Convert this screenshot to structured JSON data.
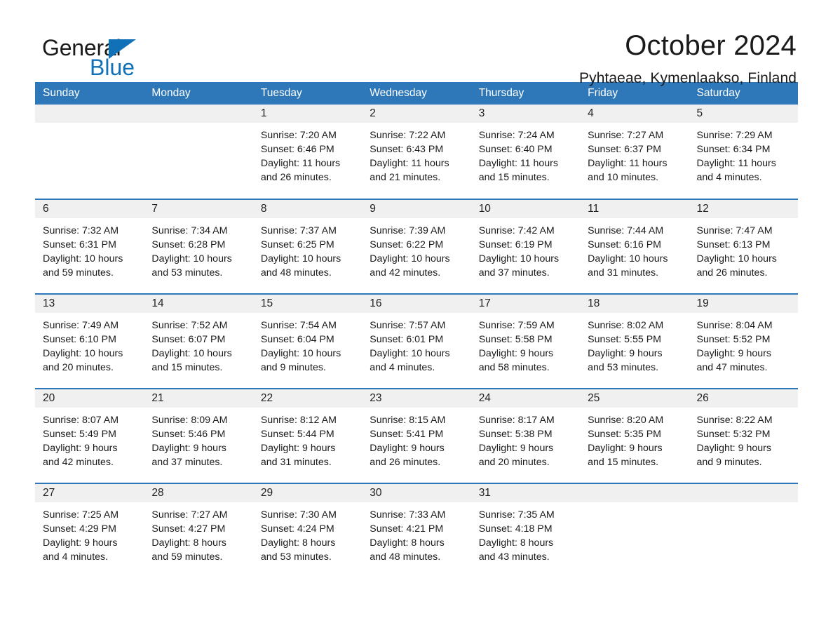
{
  "brand": {
    "name_part1": "General",
    "name_part2": "Blue",
    "logo_icon": "triangle-logo-icon",
    "accent_color": "#1071b8"
  },
  "header": {
    "month_title": "October 2024",
    "location": "Pyhtaeae, Kymenlaakso, Finland"
  },
  "colors": {
    "header_band": "#2e77b8",
    "week_divider": "#2e77b8",
    "daynum_strip": "#f0f0f0"
  },
  "calendar": {
    "weekday_headers": [
      "Sunday",
      "Monday",
      "Tuesday",
      "Wednesday",
      "Thursday",
      "Friday",
      "Saturday"
    ],
    "weeks": [
      [
        {
          "day": "",
          "empty": true,
          "sunrise": "",
          "sunset": "",
          "daylight_line1": "",
          "daylight_line2": ""
        },
        {
          "day": "",
          "empty": true,
          "sunrise": "",
          "sunset": "",
          "daylight_line1": "",
          "daylight_line2": ""
        },
        {
          "day": "1",
          "empty": false,
          "sunrise": "Sunrise: 7:20 AM",
          "sunset": "Sunset: 6:46 PM",
          "daylight_line1": "Daylight: 11 hours",
          "daylight_line2": "and 26 minutes."
        },
        {
          "day": "2",
          "empty": false,
          "sunrise": "Sunrise: 7:22 AM",
          "sunset": "Sunset: 6:43 PM",
          "daylight_line1": "Daylight: 11 hours",
          "daylight_line2": "and 21 minutes."
        },
        {
          "day": "3",
          "empty": false,
          "sunrise": "Sunrise: 7:24 AM",
          "sunset": "Sunset: 6:40 PM",
          "daylight_line1": "Daylight: 11 hours",
          "daylight_line2": "and 15 minutes."
        },
        {
          "day": "4",
          "empty": false,
          "sunrise": "Sunrise: 7:27 AM",
          "sunset": "Sunset: 6:37 PM",
          "daylight_line1": "Daylight: 11 hours",
          "daylight_line2": "and 10 minutes."
        },
        {
          "day": "5",
          "empty": false,
          "sunrise": "Sunrise: 7:29 AM",
          "sunset": "Sunset: 6:34 PM",
          "daylight_line1": "Daylight: 11 hours",
          "daylight_line2": "and 4 minutes."
        }
      ],
      [
        {
          "day": "6",
          "empty": false,
          "sunrise": "Sunrise: 7:32 AM",
          "sunset": "Sunset: 6:31 PM",
          "daylight_line1": "Daylight: 10 hours",
          "daylight_line2": "and 59 minutes."
        },
        {
          "day": "7",
          "empty": false,
          "sunrise": "Sunrise: 7:34 AM",
          "sunset": "Sunset: 6:28 PM",
          "daylight_line1": "Daylight: 10 hours",
          "daylight_line2": "and 53 minutes."
        },
        {
          "day": "8",
          "empty": false,
          "sunrise": "Sunrise: 7:37 AM",
          "sunset": "Sunset: 6:25 PM",
          "daylight_line1": "Daylight: 10 hours",
          "daylight_line2": "and 48 minutes."
        },
        {
          "day": "9",
          "empty": false,
          "sunrise": "Sunrise: 7:39 AM",
          "sunset": "Sunset: 6:22 PM",
          "daylight_line1": "Daylight: 10 hours",
          "daylight_line2": "and 42 minutes."
        },
        {
          "day": "10",
          "empty": false,
          "sunrise": "Sunrise: 7:42 AM",
          "sunset": "Sunset: 6:19 PM",
          "daylight_line1": "Daylight: 10 hours",
          "daylight_line2": "and 37 minutes."
        },
        {
          "day": "11",
          "empty": false,
          "sunrise": "Sunrise: 7:44 AM",
          "sunset": "Sunset: 6:16 PM",
          "daylight_line1": "Daylight: 10 hours",
          "daylight_line2": "and 31 minutes."
        },
        {
          "day": "12",
          "empty": false,
          "sunrise": "Sunrise: 7:47 AM",
          "sunset": "Sunset: 6:13 PM",
          "daylight_line1": "Daylight: 10 hours",
          "daylight_line2": "and 26 minutes."
        }
      ],
      [
        {
          "day": "13",
          "empty": false,
          "sunrise": "Sunrise: 7:49 AM",
          "sunset": "Sunset: 6:10 PM",
          "daylight_line1": "Daylight: 10 hours",
          "daylight_line2": "and 20 minutes."
        },
        {
          "day": "14",
          "empty": false,
          "sunrise": "Sunrise: 7:52 AM",
          "sunset": "Sunset: 6:07 PM",
          "daylight_line1": "Daylight: 10 hours",
          "daylight_line2": "and 15 minutes."
        },
        {
          "day": "15",
          "empty": false,
          "sunrise": "Sunrise: 7:54 AM",
          "sunset": "Sunset: 6:04 PM",
          "daylight_line1": "Daylight: 10 hours",
          "daylight_line2": "and 9 minutes."
        },
        {
          "day": "16",
          "empty": false,
          "sunrise": "Sunrise: 7:57 AM",
          "sunset": "Sunset: 6:01 PM",
          "daylight_line1": "Daylight: 10 hours",
          "daylight_line2": "and 4 minutes."
        },
        {
          "day": "17",
          "empty": false,
          "sunrise": "Sunrise: 7:59 AM",
          "sunset": "Sunset: 5:58 PM",
          "daylight_line1": "Daylight: 9 hours",
          "daylight_line2": "and 58 minutes."
        },
        {
          "day": "18",
          "empty": false,
          "sunrise": "Sunrise: 8:02 AM",
          "sunset": "Sunset: 5:55 PM",
          "daylight_line1": "Daylight: 9 hours",
          "daylight_line2": "and 53 minutes."
        },
        {
          "day": "19",
          "empty": false,
          "sunrise": "Sunrise: 8:04 AM",
          "sunset": "Sunset: 5:52 PM",
          "daylight_line1": "Daylight: 9 hours",
          "daylight_line2": "and 47 minutes."
        }
      ],
      [
        {
          "day": "20",
          "empty": false,
          "sunrise": "Sunrise: 8:07 AM",
          "sunset": "Sunset: 5:49 PM",
          "daylight_line1": "Daylight: 9 hours",
          "daylight_line2": "and 42 minutes."
        },
        {
          "day": "21",
          "empty": false,
          "sunrise": "Sunrise: 8:09 AM",
          "sunset": "Sunset: 5:46 PM",
          "daylight_line1": "Daylight: 9 hours",
          "daylight_line2": "and 37 minutes."
        },
        {
          "day": "22",
          "empty": false,
          "sunrise": "Sunrise: 8:12 AM",
          "sunset": "Sunset: 5:44 PM",
          "daylight_line1": "Daylight: 9 hours",
          "daylight_line2": "and 31 minutes."
        },
        {
          "day": "23",
          "empty": false,
          "sunrise": "Sunrise: 8:15 AM",
          "sunset": "Sunset: 5:41 PM",
          "daylight_line1": "Daylight: 9 hours",
          "daylight_line2": "and 26 minutes."
        },
        {
          "day": "24",
          "empty": false,
          "sunrise": "Sunrise: 8:17 AM",
          "sunset": "Sunset: 5:38 PM",
          "daylight_line1": "Daylight: 9 hours",
          "daylight_line2": "and 20 minutes."
        },
        {
          "day": "25",
          "empty": false,
          "sunrise": "Sunrise: 8:20 AM",
          "sunset": "Sunset: 5:35 PM",
          "daylight_line1": "Daylight: 9 hours",
          "daylight_line2": "and 15 minutes."
        },
        {
          "day": "26",
          "empty": false,
          "sunrise": "Sunrise: 8:22 AM",
          "sunset": "Sunset: 5:32 PM",
          "daylight_line1": "Daylight: 9 hours",
          "daylight_line2": "and 9 minutes."
        }
      ],
      [
        {
          "day": "27",
          "empty": false,
          "sunrise": "Sunrise: 7:25 AM",
          "sunset": "Sunset: 4:29 PM",
          "daylight_line1": "Daylight: 9 hours",
          "daylight_line2": "and 4 minutes."
        },
        {
          "day": "28",
          "empty": false,
          "sunrise": "Sunrise: 7:27 AM",
          "sunset": "Sunset: 4:27 PM",
          "daylight_line1": "Daylight: 8 hours",
          "daylight_line2": "and 59 minutes."
        },
        {
          "day": "29",
          "empty": false,
          "sunrise": "Sunrise: 7:30 AM",
          "sunset": "Sunset: 4:24 PM",
          "daylight_line1": "Daylight: 8 hours",
          "daylight_line2": "and 53 minutes."
        },
        {
          "day": "30",
          "empty": false,
          "sunrise": "Sunrise: 7:33 AM",
          "sunset": "Sunset: 4:21 PM",
          "daylight_line1": "Daylight: 8 hours",
          "daylight_line2": "and 48 minutes."
        },
        {
          "day": "31",
          "empty": false,
          "sunrise": "Sunrise: 7:35 AM",
          "sunset": "Sunset: 4:18 PM",
          "daylight_line1": "Daylight: 8 hours",
          "daylight_line2": "and 43 minutes."
        },
        {
          "day": "",
          "empty": true,
          "sunrise": "",
          "sunset": "",
          "daylight_line1": "",
          "daylight_line2": ""
        },
        {
          "day": "",
          "empty": true,
          "sunrise": "",
          "sunset": "",
          "daylight_line1": "",
          "daylight_line2": ""
        }
      ]
    ]
  }
}
